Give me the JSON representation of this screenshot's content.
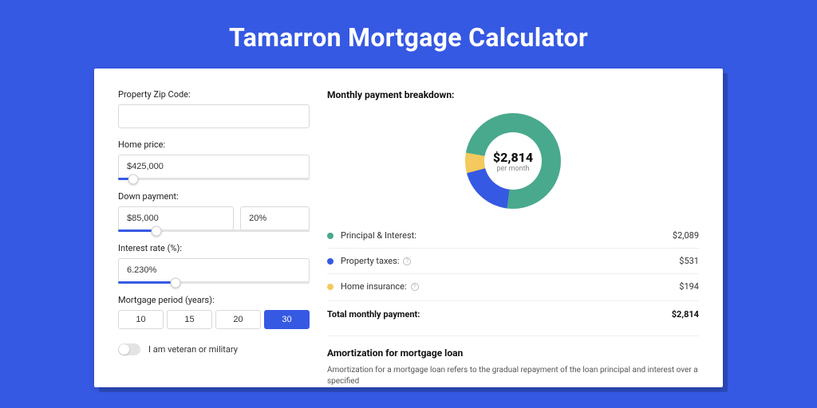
{
  "title": "Tamarron Mortgage Calculator",
  "form": {
    "zip": {
      "label": "Property Zip Code:",
      "value": ""
    },
    "home_price": {
      "label": "Home price:",
      "value": "$425,000",
      "slider_pct": 8
    },
    "down_payment": {
      "label": "Down payment:",
      "value": "$85,000",
      "pct_value": "20%",
      "slider_pct": 20
    },
    "interest": {
      "label": "Interest rate (%):",
      "value": "6.230%",
      "slider_pct": 30
    },
    "period": {
      "label": "Mortgage period (years):",
      "options": [
        "10",
        "15",
        "20",
        "30"
      ],
      "selected": "30"
    },
    "veteran": {
      "label": "I am veteran or military",
      "on": false
    }
  },
  "breakdown": {
    "heading": "Monthly payment breakdown:",
    "donut": {
      "value": "$2,814",
      "sub": "per month"
    },
    "items": [
      {
        "color": "#49A98D",
        "label": "Principal & Interest:",
        "value": "$2,089",
        "info": false
      },
      {
        "color": "#3659E3",
        "label": "Property taxes:",
        "value": "$531",
        "info": true
      },
      {
        "color": "#F4C95D",
        "label": "Home insurance:",
        "value": "$194",
        "info": true
      }
    ],
    "total": {
      "label": "Total monthly payment:",
      "value": "$2,814"
    }
  },
  "amort": {
    "title": "Amortization for mortgage loan",
    "body": "Amortization for a mortgage loan refers to the gradual repayment of the loan principal and interest over a specified"
  },
  "chart_data": {
    "type": "pie",
    "title": "Monthly payment breakdown",
    "series": [
      {
        "name": "Principal & Interest",
        "value": 2089,
        "color": "#49A98D"
      },
      {
        "name": "Property taxes",
        "value": 531,
        "color": "#3659E3"
      },
      {
        "name": "Home insurance",
        "value": 194,
        "color": "#F4C95D"
      }
    ],
    "total": 2814
  }
}
